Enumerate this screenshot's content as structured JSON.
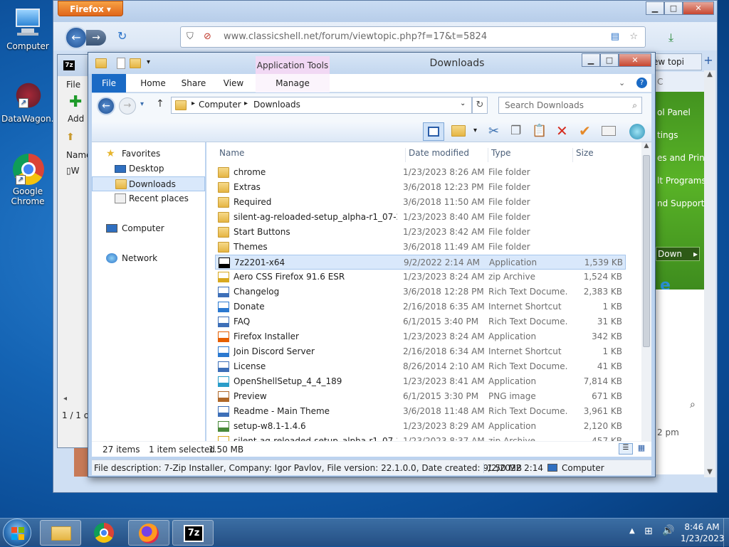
{
  "desktop": {
    "icons": [
      {
        "label": "Computer"
      },
      {
        "label": "DataWagon..."
      },
      {
        "label": "Google Chrome"
      }
    ]
  },
  "firefox": {
    "menu_button": "Firefox",
    "url": "www.classicshell.net/forum/viewtopic.php?f=17&t=5824",
    "tab_partial": "ew topi",
    "behind_text": [
      "ol Panel",
      "tings",
      "es and Printe",
      "lt Programs",
      "nd Support"
    ],
    "down_button": "Down",
    "time_partial": "2 pm",
    "edge_digit": "1",
    "edge_letter": "u"
  },
  "sevenzip_window": {
    "menu_file": "File",
    "add_label": "Add",
    "col_name": "Name",
    "row_partial": "W",
    "status_partial": "1 / 1 o"
  },
  "explorer": {
    "title": "Downloads",
    "context_tab_group": "Application Tools",
    "tabs": [
      "File",
      "Home",
      "Share",
      "View",
      "Manage"
    ],
    "breadcrumb": [
      "Computer",
      "Downloads"
    ],
    "search_placeholder": "Search Downloads",
    "columns": {
      "name": "Name",
      "date": "Date modified",
      "type": "Type",
      "size": "Size"
    },
    "nav": {
      "favorites": "Favorites",
      "desktop": "Desktop",
      "downloads": "Downloads",
      "recent": "Recent places",
      "computer": "Computer",
      "network": "Network"
    },
    "files": [
      {
        "name": "chrome",
        "date": "1/23/2023 8:26 AM",
        "type": "File folder",
        "size": "",
        "icon": "folder"
      },
      {
        "name": "Extras",
        "date": "3/6/2018 12:23 PM",
        "type": "File folder",
        "size": "",
        "icon": "folder"
      },
      {
        "name": "Required",
        "date": "3/6/2018 11:50 AM",
        "type": "File folder",
        "size": "",
        "icon": "folder"
      },
      {
        "name": "silent-ag-reloaded-setup_alpha-r1_07-21...",
        "date": "1/23/2023 8:40 AM",
        "type": "File folder",
        "size": "",
        "icon": "folder"
      },
      {
        "name": "Start Buttons",
        "date": "1/23/2023 8:42 AM",
        "type": "File folder",
        "size": "",
        "icon": "folder"
      },
      {
        "name": "Themes",
        "date": "3/6/2018 11:49 AM",
        "type": "File folder",
        "size": "",
        "icon": "folder"
      },
      {
        "name": "7z2201-x64",
        "date": "9/2/2022 2:14 AM",
        "type": "Application",
        "size": "1,539 KB",
        "icon": "7zip",
        "selected": true
      },
      {
        "name": "Aero CSS Firefox 91.6 ESR",
        "date": "1/23/2023 8:24 AM",
        "type": "zip Archive",
        "size": "1,524 KB",
        "icon": "zip"
      },
      {
        "name": "Changelog",
        "date": "3/6/2018 12:28 PM",
        "type": "Rich Text Docume...",
        "size": "2,383 KB",
        "icon": "doc"
      },
      {
        "name": "Donate",
        "date": "2/16/2018 6:35 AM",
        "type": "Internet Shortcut",
        "size": "1 KB",
        "icon": "link"
      },
      {
        "name": "FAQ",
        "date": "6/1/2015 3:40 PM",
        "type": "Rich Text Docume...",
        "size": "31 KB",
        "icon": "doc"
      },
      {
        "name": "Firefox Installer",
        "date": "1/23/2023 8:24 AM",
        "type": "Application",
        "size": "342 KB",
        "icon": "firefox"
      },
      {
        "name": "Join Discord Server",
        "date": "2/16/2018 6:34 AM",
        "type": "Internet Shortcut",
        "size": "1 KB",
        "icon": "link"
      },
      {
        "name": "License",
        "date": "8/26/2014 2:10 AM",
        "type": "Rich Text Docume...",
        "size": "41 KB",
        "icon": "doc"
      },
      {
        "name": "OpenShellSetup_4_4_189",
        "date": "1/23/2023 8:41 AM",
        "type": "Application",
        "size": "7,814 KB",
        "icon": "shell"
      },
      {
        "name": "Preview",
        "date": "6/1/2015 3:30 PM",
        "type": "PNG image",
        "size": "671 KB",
        "icon": "image"
      },
      {
        "name": "Readme - Main Theme",
        "date": "3/6/2018 11:48 AM",
        "type": "Rich Text Docume...",
        "size": "3,961 KB",
        "icon": "doc"
      },
      {
        "name": "setup-w8.1-1.4.6",
        "date": "1/23/2023 8:29 AM",
        "type": "Application",
        "size": "2,120 KB",
        "icon": "setup"
      },
      {
        "name": "silent-ag-reloaded-setup_alpha-r1_07-21...",
        "date": "1/23/2023 8:37 AM",
        "type": "zip Archive",
        "size": "457 KB",
        "icon": "zip"
      }
    ],
    "status": {
      "count": "27 items",
      "selected": "1 item selected",
      "size": "1.50 MB"
    },
    "details_bar": {
      "description": "File description: 7-Zip Installer, Company: Igor Pavlov, File version: 22.1.0.0, Date created: 9/2/2022 2:14",
      "size": "1.50 MB",
      "location": "Computer"
    }
  },
  "taskbar": {
    "time": "8:46 AM",
    "date": "1/23/2023",
    "sevenzip_label": "7z"
  }
}
